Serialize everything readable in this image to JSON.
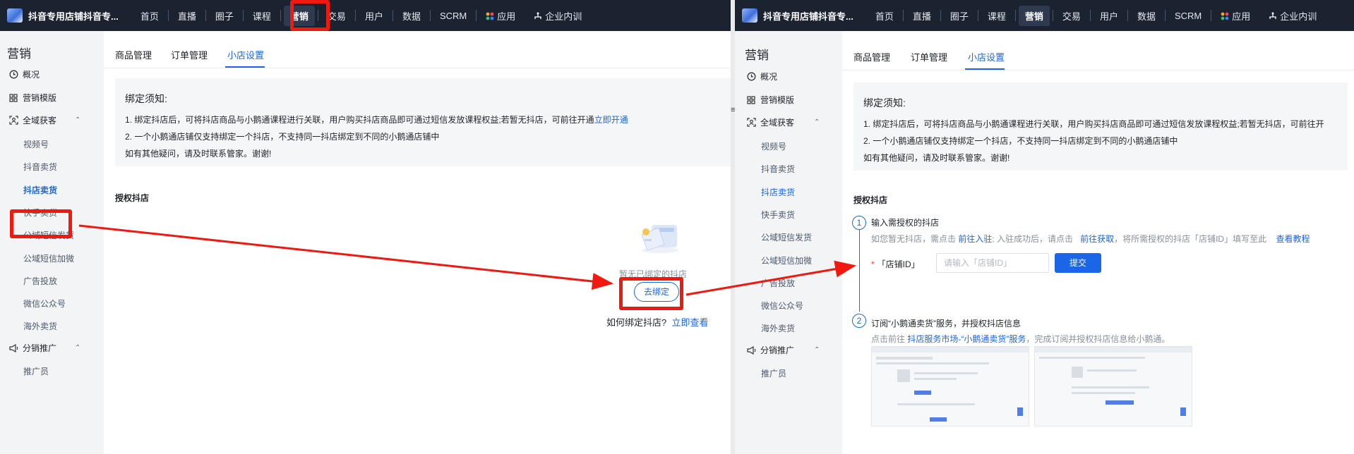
{
  "nav": {
    "title": "抖音专用店铺抖音专...",
    "items": [
      "首页",
      "直播",
      "圈子",
      "课程",
      "营销",
      "交易",
      "用户",
      "数据",
      "SCRM"
    ],
    "active": "营销",
    "apps": "应用",
    "training": "企业内训"
  },
  "sidebar": {
    "title": "营销",
    "overview": "概况",
    "templates": "营销模版",
    "acquisition": "全域获客",
    "sub_items": [
      "视频号",
      "抖音卖货",
      "抖店卖货",
      "快手卖货",
      "公域短信发货",
      "公域短信加微",
      "广告投放",
      "微信公众号",
      "海外卖货"
    ],
    "active_sub": "抖店卖货",
    "distribution": "分销推广",
    "promoter": "推广员"
  },
  "tabs": [
    "商品管理",
    "订单管理",
    "小店设置"
  ],
  "active_tab": "小店设置",
  "notice": {
    "title": "绑定须知:",
    "line1_text": "1. 绑定抖店后，可将抖店商品与小鹅通课程进行关联，用户购买抖店商品即可通过短信发放课程权益;若暂无抖店，可前往开通",
    "line1_link": "立即开通",
    "line1_text_right": "1. 绑定抖店后，可将抖店商品与小鹅通课程进行关联，用户购买抖店商品即可通过短信发放课程权益;若暂无抖店，可前往开",
    "line2": "2. 一个小鹅通店铺仅支持绑定一个抖店，不支持同一抖店绑定到不同的小鹅通店铺中",
    "line3": "如有其他疑问，请及时联系管家。谢谢!"
  },
  "section_title": "授权抖店",
  "empty": {
    "text": "暂无已绑定的抖店",
    "bind_button": "去绑定",
    "howto": "如何绑定抖店?",
    "howto_link": "立即查看"
  },
  "steps": {
    "step1_number": "1",
    "step1_title": "输入需授权的抖店",
    "step1_desc_a": "如您暂无抖店，需点击",
    "step1_link_a": "前往入驻",
    "step1_desc_b": "; 入驻成功后，请点击",
    "step1_link_b": "前往获取",
    "step1_desc_c": "，将所需授权的抖店「店铺ID」填写至此",
    "step1_link_c": "查看教程",
    "field_label": "「店铺ID」",
    "field_placeholder": "请输入「店铺ID」",
    "submit": "提交",
    "step2_number": "2",
    "step2_title": "订阅“小鹅通卖货”服务，并授权抖店信息",
    "step2_desc_a": "点击前往",
    "step2_link": "抖店服务市场-“小鹅通卖货”服务",
    "step2_desc_b": "，完成订阅并授权抖店信息给小鹅通。"
  },
  "colors": {
    "accent": "#1a66e6",
    "annotation_red": "#f0180f",
    "nav_bg": "#1b2230"
  }
}
